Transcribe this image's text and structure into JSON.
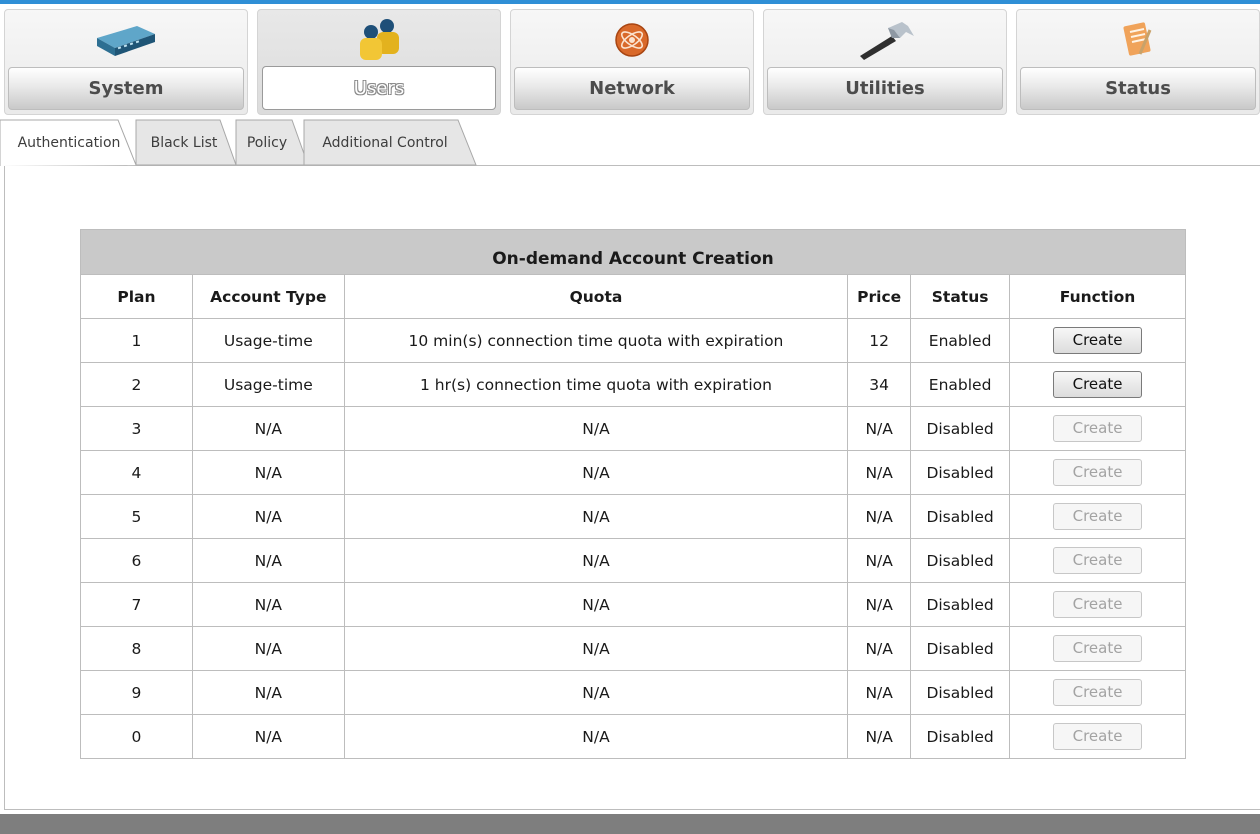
{
  "nav": {
    "items": [
      {
        "label": "System",
        "icon": "router-device-icon",
        "active": false
      },
      {
        "label": "Users",
        "icon": "users-icon",
        "active": true
      },
      {
        "label": "Network",
        "icon": "network-globe-icon",
        "active": false
      },
      {
        "label": "Utilities",
        "icon": "hammer-icon",
        "active": false
      },
      {
        "label": "Status",
        "icon": "notepad-icon",
        "active": false
      }
    ]
  },
  "subtabs": [
    {
      "label": "Authentication",
      "active": true
    },
    {
      "label": "Black List",
      "active": false
    },
    {
      "label": "Policy",
      "active": false
    },
    {
      "label": "Additional Control",
      "active": false
    }
  ],
  "table": {
    "title": "On-demand Account Creation",
    "columns": [
      "Plan",
      "Account Type",
      "Quota",
      "Price",
      "Status",
      "Function"
    ],
    "rows": [
      {
        "plan": "1",
        "account_type": "Usage-time",
        "quota": "10 min(s) connection time quota with expiration",
        "price": "12",
        "status": "Enabled",
        "function": "Create",
        "enabled": true
      },
      {
        "plan": "2",
        "account_type": "Usage-time",
        "quota": "1 hr(s) connection time quota with expiration",
        "price": "34",
        "status": "Enabled",
        "function": "Create",
        "enabled": true
      },
      {
        "plan": "3",
        "account_type": "N/A",
        "quota": "N/A",
        "price": "N/A",
        "status": "Disabled",
        "function": "Create",
        "enabled": false
      },
      {
        "plan": "4",
        "account_type": "N/A",
        "quota": "N/A",
        "price": "N/A",
        "status": "Disabled",
        "function": "Create",
        "enabled": false
      },
      {
        "plan": "5",
        "account_type": "N/A",
        "quota": "N/A",
        "price": "N/A",
        "status": "Disabled",
        "function": "Create",
        "enabled": false
      },
      {
        "plan": "6",
        "account_type": "N/A",
        "quota": "N/A",
        "price": "N/A",
        "status": "Disabled",
        "function": "Create",
        "enabled": false
      },
      {
        "plan": "7",
        "account_type": "N/A",
        "quota": "N/A",
        "price": "N/A",
        "status": "Disabled",
        "function": "Create",
        "enabled": false
      },
      {
        "plan": "8",
        "account_type": "N/A",
        "quota": "N/A",
        "price": "N/A",
        "status": "Disabled",
        "function": "Create",
        "enabled": false
      },
      {
        "plan": "9",
        "account_type": "N/A",
        "quota": "N/A",
        "price": "N/A",
        "status": "Disabled",
        "function": "Create",
        "enabled": false
      },
      {
        "plan": "0",
        "account_type": "N/A",
        "quota": "N/A",
        "price": "N/A",
        "status": "Disabled",
        "function": "Create",
        "enabled": false
      }
    ]
  },
  "colors": {
    "accent_top_line": "#2f8fd6",
    "table_title_bg": "#c9c9c9",
    "footer_bar": "#7e7e7e"
  }
}
